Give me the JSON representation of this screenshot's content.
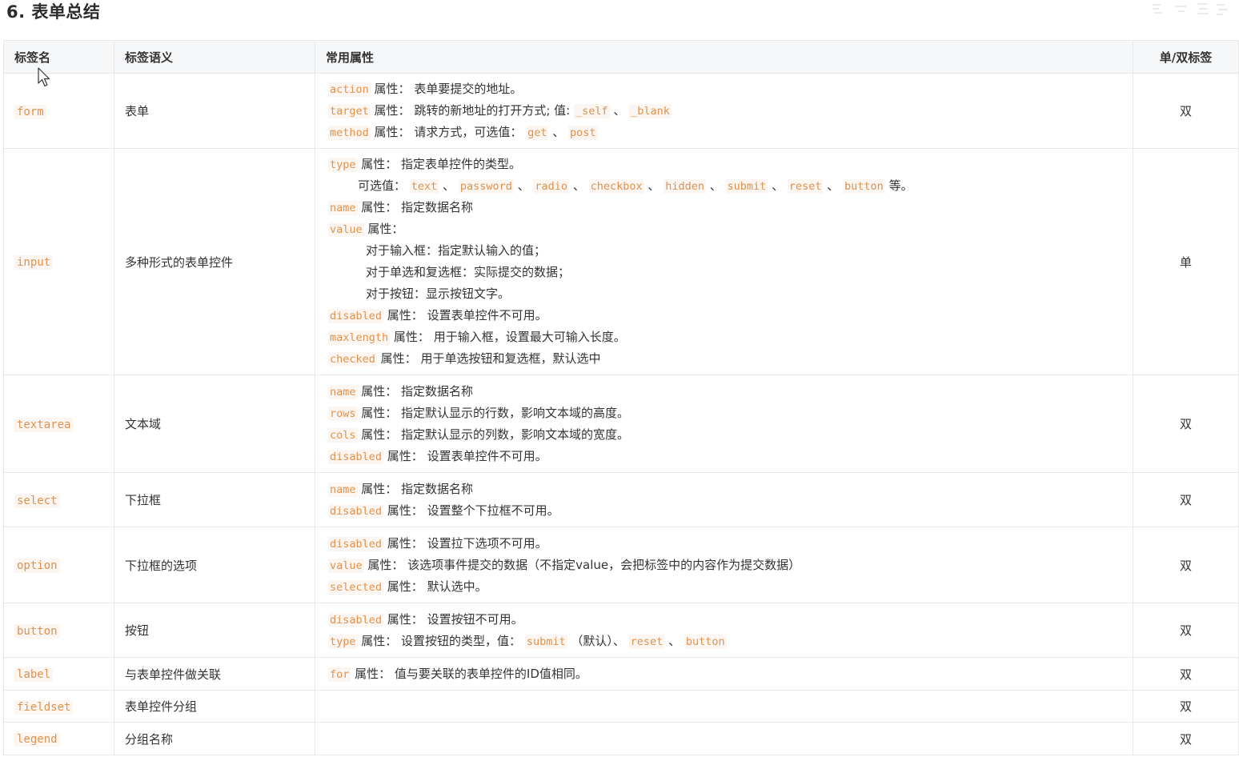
{
  "page": {
    "title": "6. 表单总结"
  },
  "table": {
    "headers": [
      "标签名",
      "标签语义",
      "常用属性",
      "单/双标签"
    ],
    "rows": [
      {
        "tag": "form",
        "meaning": "表单",
        "type": "双",
        "lines": [
          {
            "indent": 0,
            "parts": [
              {
                "code": "action"
              },
              {
                "text": " 属性： 表单要提交的地址。"
              }
            ]
          },
          {
            "indent": 0,
            "parts": [
              {
                "code": "target"
              },
              {
                "text": " 属性： 跳转的新地址的打开方式; 值: "
              },
              {
                "code": "_self"
              },
              {
                "text": " 、 "
              },
              {
                "code": "_blank"
              }
            ]
          },
          {
            "indent": 0,
            "parts": [
              {
                "code": "method"
              },
              {
                "text": " 属性： 请求方式，可选值： "
              },
              {
                "code": "get"
              },
              {
                "text": " 、 "
              },
              {
                "code": "post"
              }
            ]
          }
        ]
      },
      {
        "tag": "input",
        "meaning": "多种形式的表单控件",
        "type": "单",
        "lines": [
          {
            "indent": 0,
            "parts": [
              {
                "code": "type"
              },
              {
                "text": " 属性： 指定表单控件的类型。"
              }
            ]
          },
          {
            "indent": 1,
            "parts": [
              {
                "text": "可选值： "
              },
              {
                "code": "text"
              },
              {
                "text": " 、 "
              },
              {
                "code": "password"
              },
              {
                "text": " 、 "
              },
              {
                "code": "radio"
              },
              {
                "text": " 、 "
              },
              {
                "code": "checkbox"
              },
              {
                "text": " 、 "
              },
              {
                "code": "hidden"
              },
              {
                "text": " 、 "
              },
              {
                "code": "submit"
              },
              {
                "text": " 、 "
              },
              {
                "code": "reset"
              },
              {
                "text": " 、 "
              },
              {
                "code": "button"
              },
              {
                "text": " 等。"
              }
            ]
          },
          {
            "indent": 0,
            "parts": [
              {
                "code": "name"
              },
              {
                "text": " 属性： 指定数据名称"
              }
            ]
          },
          {
            "indent": 0,
            "parts": [
              {
                "code": "value"
              },
              {
                "text": " 属性："
              }
            ]
          },
          {
            "indent": 2,
            "parts": [
              {
                "text": "对于输入框：指定默认输入的值；"
              }
            ]
          },
          {
            "indent": 2,
            "parts": [
              {
                "text": "对于单选和复选框：实际提交的数据；"
              }
            ]
          },
          {
            "indent": 2,
            "parts": [
              {
                "text": "对于按钮：显示按钮文字。"
              }
            ]
          },
          {
            "indent": 0,
            "parts": [
              {
                "code": "disabled"
              },
              {
                "text": " 属性： 设置表单控件不可用。"
              }
            ]
          },
          {
            "indent": 0,
            "parts": [
              {
                "code": "maxlength"
              },
              {
                "text": " 属性： 用于输入框，设置最大可输入长度。"
              }
            ]
          },
          {
            "indent": 0,
            "parts": [
              {
                "code": "checked"
              },
              {
                "text": " 属性： 用于单选按钮和复选框，默认选中"
              }
            ]
          }
        ]
      },
      {
        "tag": "textarea",
        "meaning": "文本域",
        "type": "双",
        "lines": [
          {
            "indent": 0,
            "parts": [
              {
                "code": "name"
              },
              {
                "text": " 属性： 指定数据名称"
              }
            ]
          },
          {
            "indent": 0,
            "parts": [
              {
                "code": "rows"
              },
              {
                "text": " 属性： 指定默认显示的行数，影响文本域的高度。"
              }
            ]
          },
          {
            "indent": 0,
            "parts": [
              {
                "code": "cols"
              },
              {
                "text": " 属性： 指定默认显示的列数，影响文本域的宽度。"
              }
            ]
          },
          {
            "indent": 0,
            "parts": [
              {
                "code": "disabled"
              },
              {
                "text": " 属性： 设置表单控件不可用。"
              }
            ]
          }
        ]
      },
      {
        "tag": "select",
        "meaning": "下拉框",
        "type": "双",
        "lines": [
          {
            "indent": 0,
            "parts": [
              {
                "code": "name"
              },
              {
                "text": " 属性： 指定数据名称"
              }
            ]
          },
          {
            "indent": 0,
            "parts": [
              {
                "code": "disabled"
              },
              {
                "text": " 属性： 设置整个下拉框不可用。"
              }
            ]
          }
        ]
      },
      {
        "tag": "option",
        "meaning": "下拉框的选项",
        "type": "双",
        "lines": [
          {
            "indent": 0,
            "parts": [
              {
                "code": "disabled"
              },
              {
                "text": " 属性： 设置拉下选项不可用。"
              }
            ]
          },
          {
            "indent": 0,
            "parts": [
              {
                "code": "value"
              },
              {
                "text": " 属性： 该选项事件提交的数据（不指定value，会把标签中的内容作为提交数据）"
              }
            ]
          },
          {
            "indent": 0,
            "parts": [
              {
                "code": "selected"
              },
              {
                "text": " 属性： 默认选中。"
              }
            ]
          }
        ]
      },
      {
        "tag": "button",
        "meaning": "按钮",
        "type": "双",
        "lines": [
          {
            "indent": 0,
            "parts": [
              {
                "code": "disabled"
              },
              {
                "text": " 属性： 设置按钮不可用。"
              }
            ]
          },
          {
            "indent": 0,
            "parts": [
              {
                "code": "type"
              },
              {
                "text": " 属性： 设置按钮的类型，值： "
              },
              {
                "code": "submit"
              },
              {
                "text": " （默认）、 "
              },
              {
                "code": "reset"
              },
              {
                "text": " 、 "
              },
              {
                "code": "button"
              }
            ]
          }
        ]
      },
      {
        "tag": "label",
        "meaning": "与表单控件做关联",
        "type": "双",
        "lines": [
          {
            "indent": 0,
            "parts": [
              {
                "code": "for"
              },
              {
                "text": " 属性： 值与要关联的表单控件的ID值相同。"
              }
            ]
          }
        ]
      },
      {
        "tag": "fieldset",
        "meaning": "表单控件分组",
        "type": "双",
        "lines": []
      },
      {
        "tag": "legend",
        "meaning": "分组名称",
        "type": "双",
        "lines": []
      }
    ]
  }
}
